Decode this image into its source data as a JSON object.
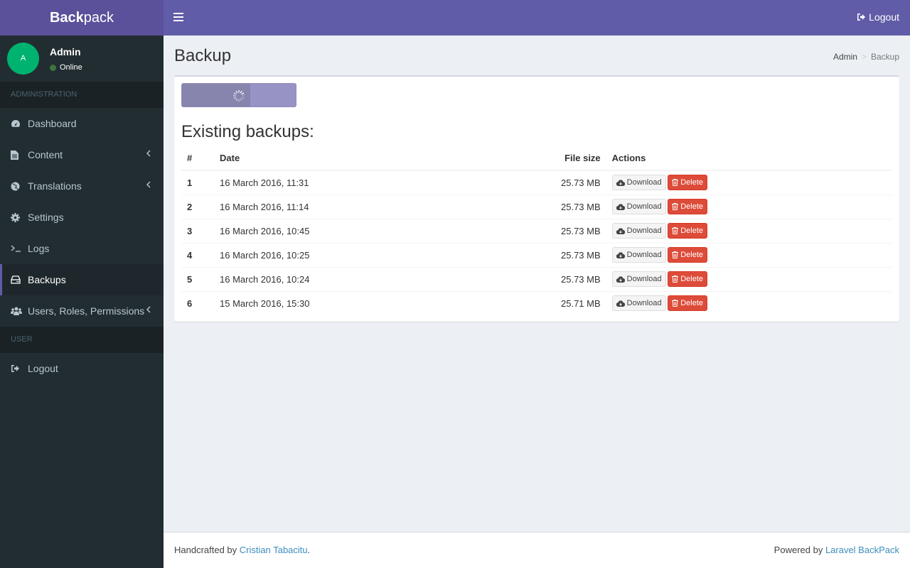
{
  "brand": {
    "bold": "Back",
    "light": "pack"
  },
  "navbar": {
    "logout_label": "Logout"
  },
  "user": {
    "initial": "A",
    "name": "Admin",
    "status": "Online"
  },
  "sidebar": {
    "sections": [
      {
        "header": "ADMINISTRATION"
      },
      {
        "header": "USER"
      }
    ],
    "items": [
      {
        "label": "Dashboard",
        "icon": "dashboard-icon"
      },
      {
        "label": "Content",
        "icon": "file-icon",
        "has_submenu": true
      },
      {
        "label": "Translations",
        "icon": "globe-icon",
        "has_submenu": true
      },
      {
        "label": "Settings",
        "icon": "gear-icon"
      },
      {
        "label": "Logs",
        "icon": "terminal-icon"
      },
      {
        "label": "Backups",
        "icon": "hdd-icon",
        "active": true
      },
      {
        "label": "Users, Roles, Permissions",
        "icon": "users-icon",
        "has_submenu": true
      },
      {
        "label": "Logout",
        "icon": "sign-out-icon"
      }
    ]
  },
  "page": {
    "title": "Backup",
    "breadcrumb": [
      "Admin",
      "Backup"
    ],
    "create_button": {
      "state": "loading",
      "progress": 0.6
    },
    "list_title": "Existing backups:"
  },
  "table": {
    "headers": [
      "#",
      "Date",
      "File size",
      "Actions"
    ],
    "rows": [
      {
        "num": "1",
        "date": "16 March 2016, 11:31",
        "size": "25.73 MB"
      },
      {
        "num": "2",
        "date": "16 March 2016, 11:14",
        "size": "25.73 MB"
      },
      {
        "num": "3",
        "date": "16 March 2016, 10:45",
        "size": "25.73 MB"
      },
      {
        "num": "4",
        "date": "16 March 2016, 10:25",
        "size": "25.73 MB"
      },
      {
        "num": "5",
        "date": "16 March 2016, 10:24",
        "size": "25.73 MB"
      },
      {
        "num": "6",
        "date": "15 March 2016, 15:30",
        "size": "25.71 MB"
      }
    ],
    "download_label": "Download",
    "delete_label": "Delete"
  },
  "footer": {
    "left_prefix": "Handcrafted by ",
    "left_link": "Cristian Tabacitu",
    "left_suffix": ".",
    "right_prefix": "Powered by ",
    "right_link": "Laravel BackPack"
  },
  "colors": {
    "brand": "#605ca8",
    "brand_dark": "#5a519a",
    "danger": "#dd4b39",
    "sidebar": "#222d32",
    "link": "#3c8dbc"
  }
}
